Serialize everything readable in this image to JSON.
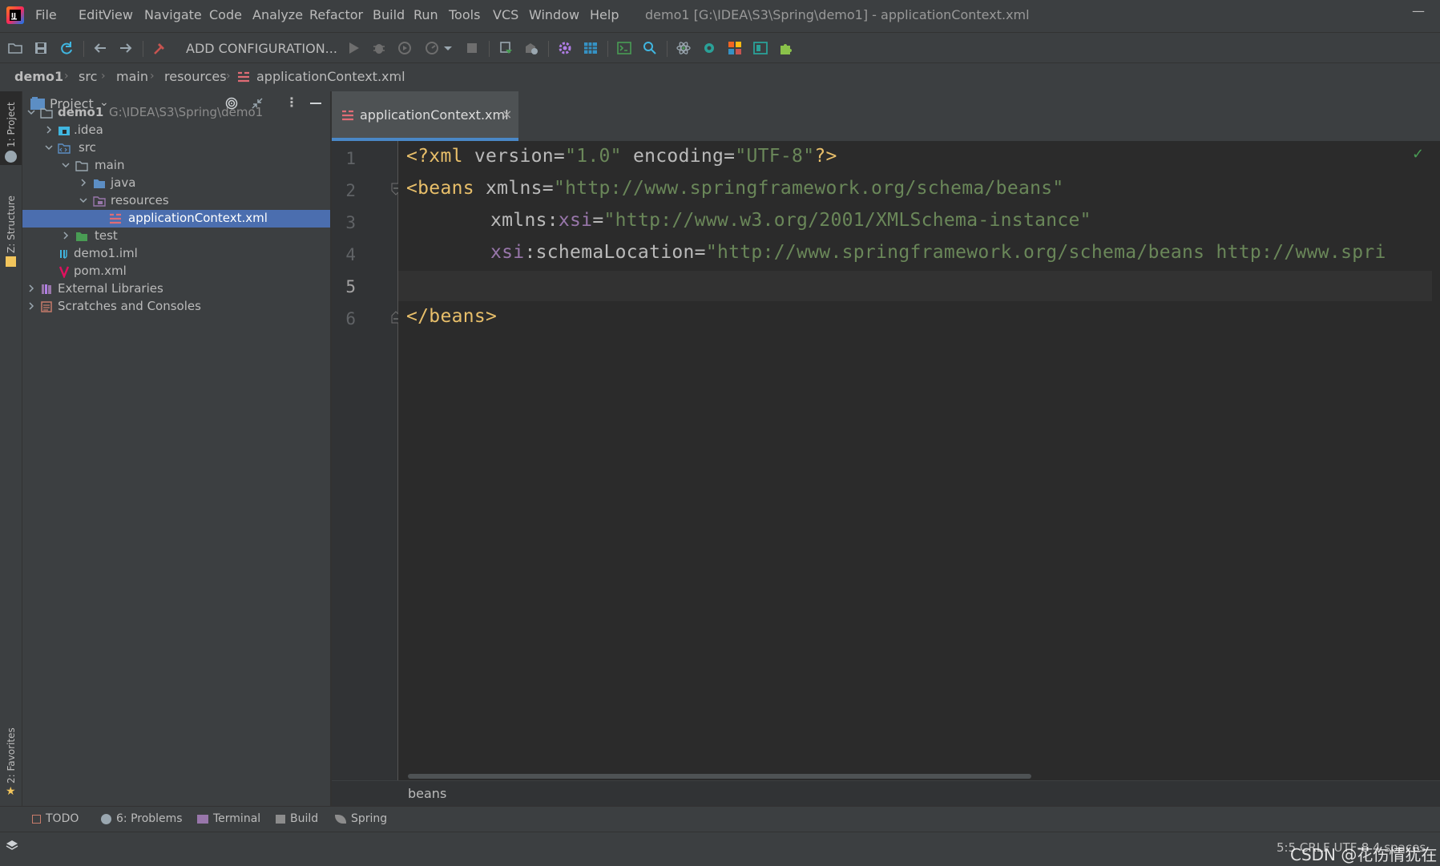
{
  "menubar": {
    "items": [
      "File",
      "Edit",
      "View",
      "Navigate",
      "Code",
      "Analyze",
      "Refactor",
      "Build",
      "Run",
      "Tools",
      "VCS",
      "Window",
      "Help"
    ],
    "window_title": "demo1 [G:\\IDEA\\S3\\Spring\\demo1] - applicationContext.xml",
    "minimize": "—"
  },
  "toolbar": {
    "add_configuration": "ADD CONFIGURATION..."
  },
  "breadcrumb": [
    "demo1",
    "src",
    "main",
    "resources",
    "applicationContext.xml"
  ],
  "left_stripe": {
    "project": "1: Project",
    "structure": "Z: Structure",
    "favorites": "2: Favorites"
  },
  "project_panel": {
    "title": "Project",
    "tree": [
      {
        "label": "demo1",
        "path": "G:\\IDEA\\S3\\Spring\\demo1"
      },
      {
        "label": ".idea"
      },
      {
        "label": "src"
      },
      {
        "label": "main"
      },
      {
        "label": "java"
      },
      {
        "label": "resources"
      },
      {
        "label": "applicationContext.xml"
      },
      {
        "label": "test"
      },
      {
        "label": "demo1.iml"
      },
      {
        "label": "pom.xml"
      },
      {
        "label": "External Libraries"
      },
      {
        "label": "Scratches and Consoles"
      }
    ]
  },
  "editor": {
    "tab_label": "applicationContext.xml",
    "tab_close": "×",
    "line_numbers": [
      "1",
      "2",
      "3",
      "4",
      "5",
      "6"
    ],
    "current_line": 5,
    "code": {
      "l1_a": "<?xml ",
      "l1_b": "version",
      "l1_c": "=",
      "l1_d": "\"1.0\"",
      "l1_e": " encoding",
      "l1_f": "=",
      "l1_g": "\"UTF-8\"",
      "l1_h": "?>",
      "l2_a": "<beans ",
      "l2_b": "xmlns",
      "l2_c": "=",
      "l2_d": "\"http://www.springframework.org/schema/beans\"",
      "l3_a": "xmlns:",
      "l3_b": "xsi",
      "l3_c": "=",
      "l3_d": "\"http://www.w3.org/2001/XMLSchema-instance\"",
      "l4_a": "xsi",
      "l4_b": ":schemaLocation",
      "l4_c": "=",
      "l4_d": "\"http://www.springframework.org/schema/beans http://www.spri",
      "l6_a": "</beans>"
    },
    "breadcrumb": "beans"
  },
  "bottom_tools": [
    "TODO",
    "6: Problems",
    "Terminal",
    "Build",
    "Spring"
  ],
  "status": {
    "text": "5:5  CRLF  UTF-8  4 spaces",
    "watermark": "CSDN @花伤情犹在"
  },
  "colors": {
    "bg": "#2b2b2b",
    "panel": "#3c3f41",
    "selection": "#4b6eaf",
    "tab_underline": "#4a88c7",
    "tag": "#e8bf6a",
    "string": "#6a8759",
    "namespace": "#9876aa"
  }
}
